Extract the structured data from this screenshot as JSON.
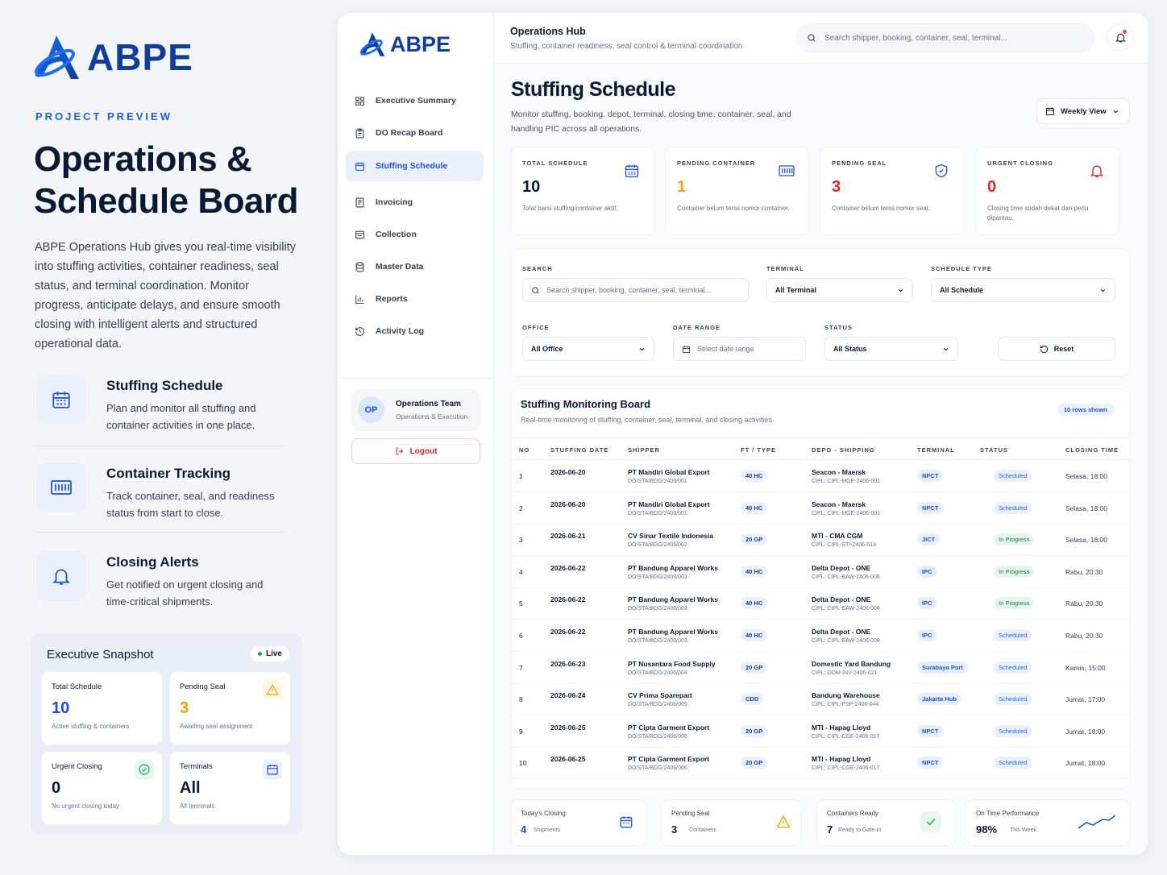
{
  "brand": {
    "name": "ABPE"
  },
  "promo": {
    "eyebrow": "PROJECT PREVIEW",
    "title": "Operations & Schedule Board",
    "description": "ABPE Operations Hub gives you real-time visibility into stuffing activities, container readiness, seal status, and terminal coordination. Monitor progress, anticipate delays, and ensure smooth closing with intelligent alerts and structured operational data.",
    "features": [
      {
        "title": "Stuffing Schedule",
        "desc": "Plan and monitor all stuffing and container activities in one place.",
        "icon": "calendar-icon"
      },
      {
        "title": "Container Tracking",
        "desc": "Track container, seal, and readiness status from start to close.",
        "icon": "container-icon"
      },
      {
        "title": "Closing Alerts",
        "desc": "Get notified on urgent closing and time-critical shipments.",
        "icon": "bell-icon"
      }
    ]
  },
  "snapshot": {
    "title": "Executive Snapshot",
    "live": "Live",
    "cards": [
      {
        "label": "Total Schedule",
        "value": "10",
        "sub": "Active stuffing & containers",
        "color": "#1d4ed8"
      },
      {
        "label": "Pending Seal",
        "value": "3",
        "sub": "Awaiting seal assignment",
        "color": "#f59e0b"
      },
      {
        "label": "Urgent Closing",
        "value": "0",
        "sub": "No urgent closing today",
        "color": "#0b1a33"
      },
      {
        "label": "Terminals",
        "value": "All",
        "sub": "All terminals",
        "color": "#0b1a33"
      }
    ]
  },
  "sidebar": {
    "items": [
      {
        "label": "Executive Summary",
        "icon": "grid-icon"
      },
      {
        "label": "DO Recap Board",
        "icon": "clipboard-icon"
      },
      {
        "label": "Stuffing Schedule",
        "icon": "calendar-icon",
        "active": true
      },
      {
        "label": "Invoicing",
        "icon": "invoice-icon"
      },
      {
        "label": "Collection",
        "icon": "collection-icon"
      },
      {
        "label": "Master Data",
        "icon": "database-icon"
      },
      {
        "label": "Reports",
        "icon": "bar-chart-icon"
      },
      {
        "label": "Activity Log",
        "icon": "history-icon"
      }
    ],
    "team": {
      "initials": "OP",
      "name": "Operations Team",
      "role": "Operations & Execution"
    },
    "logout": "Logout"
  },
  "topbar": {
    "title": "Operations Hub",
    "subtitle": "Stuffing, container readiness, seal control & terminal coordination",
    "search_placeholder": "Search shipper, booking, container, seal, terminal..."
  },
  "page": {
    "title": "Stuffing Schedule",
    "description": "Monitor stuffing, booking, depot, terminal, closing time, container, seal, and handling PIC across all operations.",
    "view": "Weekly View"
  },
  "kpis": [
    {
      "label": "TOTAL SCHEDULE",
      "value": "10",
      "desc": "Total barsi stuffing/container aktif.",
      "color": "#0b1a33"
    },
    {
      "label": "PENDING CONTAINER",
      "value": "1",
      "desc": "Container belum terisi nomor container.",
      "color": "#f59e0b"
    },
    {
      "label": "PENDING SEAL",
      "value": "3",
      "desc": "Container belum terisi nomor seal.",
      "color": "#dc2626"
    },
    {
      "label": "URGENT CLOSING",
      "value": "0",
      "desc": "Closing time sudah dekat dan perlu dipantau.",
      "color": "#dc2626"
    }
  ],
  "filters": {
    "search_label": "SEARCH",
    "search_placeholder": "Search shipper, booking, container, seal, terminal...",
    "terminal_label": "TERMINAL",
    "terminal_value": "All Terminal",
    "schedule_type_label": "SCHEDULE TYPE",
    "schedule_type_value": "All Schedule",
    "office_label": "OFFICE",
    "office_value": "All Office",
    "date_range_label": "DATE RANGE",
    "date_range_placeholder": "Select date range",
    "status_label": "STATUS",
    "status_value": "All Status",
    "reset": "Reset"
  },
  "board": {
    "title": "Stuffing Monitoring Board",
    "subtitle": "Real-time monitoring of stuffing, container, seal, terminal, and closing activities.",
    "rows_shown": "10 rows shown",
    "columns": [
      "NO",
      "STUFFING DATE",
      "SHIPPER",
      "FT / TYPE",
      "DEPO - SHIPPING",
      "TERMINAL",
      "STATUS",
      "CLOSING TIME"
    ],
    "rows": [
      {
        "no": "1",
        "date": "2026-06-20",
        "shipper": "PT Mandiri Global Export",
        "do": "DO/STA/BDG/2406/001",
        "type": "40 HC",
        "depo": "Seacon - Maersk",
        "cipl": "CIPL: CIPL-MGE-2406-001",
        "terminal": "NPCT",
        "status": "Scheduled",
        "closing": "Selasa, 18:00"
      },
      {
        "no": "2",
        "date": "2026-06-20",
        "shipper": "PT Mandiri Global Export",
        "do": "DO/STA/BDG/2406/001",
        "type": "40 HC",
        "depo": "Seacon - Maersk",
        "cipl": "CIPL: CIPL-MGE-2406-001",
        "terminal": "NPCT",
        "status": "Scheduled",
        "closing": "Selasa, 18:00"
      },
      {
        "no": "3",
        "date": "2026-06-21",
        "shipper": "CV Sinar Textile Indonesia",
        "do": "DO/STA/BDG/2406/002",
        "type": "20 GP",
        "depo": "MTI - CMA CGM",
        "cipl": "CIPL: CIPL-STI-2406-014",
        "terminal": "JICT",
        "status": "In Progress",
        "closing": "Selasa, 18:00"
      },
      {
        "no": "4",
        "date": "2026-06-22",
        "shipper": "PT Bandung Apparel Works",
        "do": "DO/STA/BDG/2406/003",
        "type": "40 HC",
        "depo": "Delta Depot - ONE",
        "cipl": "CIPL: CIPL-BAW-2406-008",
        "terminal": "IPC",
        "status": "In Progress",
        "closing": "Rabu, 20:30"
      },
      {
        "no": "5",
        "date": "2026-06-22",
        "shipper": "PT Bandung Apparel Works",
        "do": "DO/STA/BDG/2406/003",
        "type": "40 HC",
        "depo": "Delta Depot - ONE",
        "cipl": "CIPL: CIPL-BAW-2406-008",
        "terminal": "IPC",
        "status": "In Progress",
        "closing": "Rabu, 20:30"
      },
      {
        "no": "6",
        "date": "2026-06-22",
        "shipper": "PT Bandung Apparel Works",
        "do": "DO/STA/BDG/2406/003",
        "type": "40 HC",
        "depo": "Delta Depot - ONE",
        "cipl": "CIPL: CIPL-BAW-2406-008",
        "terminal": "IPC",
        "status": "Scheduled",
        "closing": "Rabu, 20:30"
      },
      {
        "no": "7",
        "date": "2026-06-23",
        "shipper": "PT Nusantara Food Supply",
        "do": "DO/STA/BDG/2406/004",
        "type": "20 GP",
        "depo": "Domestic Yard Bandung",
        "cipl": "CIPL: DOM-INV-2406-021",
        "terminal": "Surabaya Port",
        "status": "Scheduled",
        "closing": "Kamis, 15:00"
      },
      {
        "no": "8",
        "date": "2026-06-24",
        "shipper": "CV Prima Sparepart",
        "do": "DO/STA/BDG/2406/005",
        "type": "CDD",
        "depo": "Bandung Warehouse",
        "cipl": "CIPL: CIPL-PSP-2406-044",
        "terminal": "Jakarta Hub",
        "status": "Scheduled",
        "closing": "Jumat, 17:00"
      },
      {
        "no": "9",
        "date": "2026-06-25",
        "shipper": "PT Cipta Garment Export",
        "do": "DO/STA/BDG/2406/006",
        "type": "20 GP",
        "depo": "MTI - Hapag Lloyd",
        "cipl": "CIPL: CIPL-CGE-2406-017",
        "terminal": "NPCT",
        "status": "Scheduled",
        "closing": "Jumat, 18:00"
      },
      {
        "no": "10",
        "date": "2026-06-25",
        "shipper": "PT Cipta Garment Export",
        "do": "DO/STA/BDG/2406/006",
        "type": "20 GP",
        "depo": "MTI - Hapag Lloyd",
        "cipl": "CIPL: CIPL-CGE-2406-017",
        "terminal": "NPCT",
        "status": "Scheduled",
        "closing": "Jumat, 18:00"
      }
    ]
  },
  "bottom": [
    {
      "label": "Today's Closing",
      "value": "4",
      "sub": "Shipments",
      "icon": "calendar-icon"
    },
    {
      "label": "Pending Seal",
      "value": "3",
      "sub": "Containers",
      "icon": "warning-icon"
    },
    {
      "label": "Containers Ready",
      "value": "7",
      "sub": "Ready to Gate-In",
      "icon": "check-icon"
    },
    {
      "label": "On Time Performance",
      "value": "98%",
      "sub": "This Week",
      "icon": "trend-icon"
    }
  ]
}
